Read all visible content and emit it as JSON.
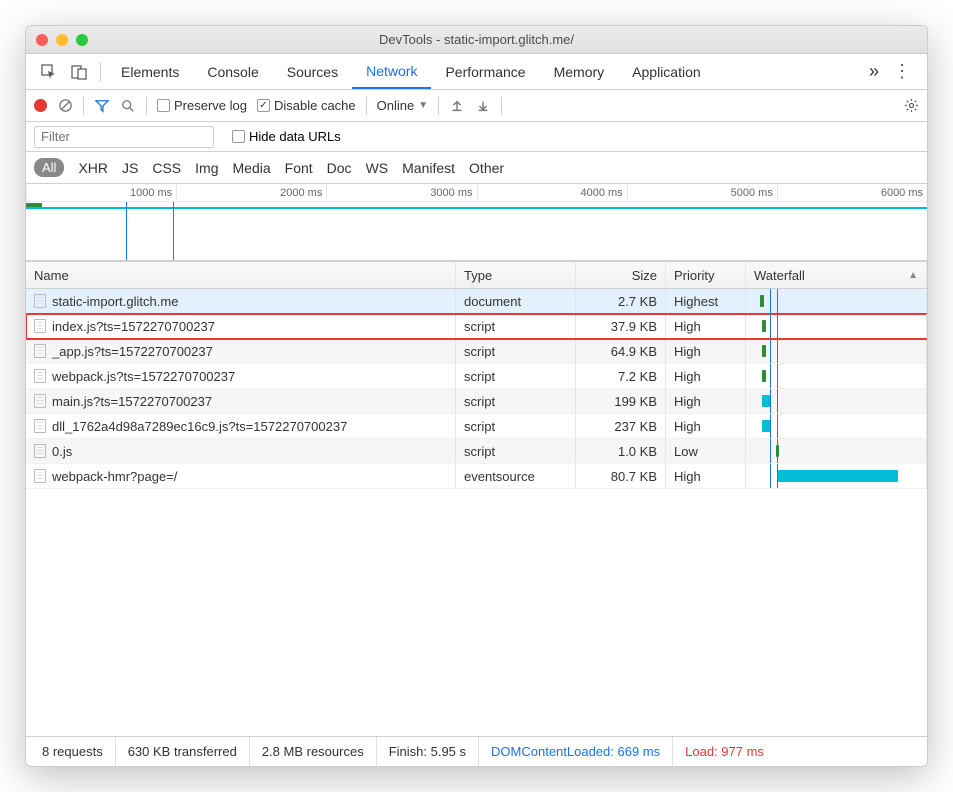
{
  "window": {
    "title": "DevTools - static-import.glitch.me/"
  },
  "tabs": [
    "Elements",
    "Console",
    "Sources",
    "Network",
    "Performance",
    "Memory",
    "Application"
  ],
  "active_tab": "Network",
  "toolbar": {
    "preserve_log_label": "Preserve log",
    "disable_cache_label": "Disable cache",
    "disable_cache_checked": true,
    "throttle": "Online"
  },
  "filter": {
    "placeholder": "Filter",
    "hide_data_urls_label": "Hide data URLs"
  },
  "types": [
    "All",
    "XHR",
    "JS",
    "CSS",
    "Img",
    "Media",
    "Font",
    "Doc",
    "WS",
    "Manifest",
    "Other"
  ],
  "timeline_ticks": [
    "1000 ms",
    "2000 ms",
    "3000 ms",
    "4000 ms",
    "5000 ms",
    "6000 ms"
  ],
  "columns": {
    "name": "Name",
    "type": "Type",
    "size": "Size",
    "priority": "Priority",
    "waterfall": "Waterfall"
  },
  "rows": [
    {
      "name": "static-import.glitch.me",
      "type": "document",
      "size": "2.7 KB",
      "priority": "Highest",
      "wf": {
        "start": 6,
        "width": 4,
        "color": "#2e8b38"
      },
      "sel": true
    },
    {
      "name": "index.js?ts=1572270700237",
      "type": "script",
      "size": "37.9 KB",
      "priority": "High",
      "wf": {
        "start": 8,
        "width": 4,
        "color": "#2e8b38"
      },
      "hl": true
    },
    {
      "name": "_app.js?ts=1572270700237",
      "type": "script",
      "size": "64.9 KB",
      "priority": "High",
      "wf": {
        "start": 8,
        "width": 4,
        "color": "#2e8b38"
      },
      "odd": true
    },
    {
      "name": "webpack.js?ts=1572270700237",
      "type": "script",
      "size": "7.2 KB",
      "priority": "High",
      "wf": {
        "start": 8,
        "width": 4,
        "color": "#2e8b38"
      }
    },
    {
      "name": "main.js?ts=1572270700237",
      "type": "script",
      "size": "199 KB",
      "priority": "High",
      "wf": {
        "start": 8,
        "width": 8,
        "color": "#00bcd4"
      },
      "odd": true
    },
    {
      "name": "dll_1762a4d98a7289ec16c9.js?ts=1572270700237",
      "type": "script",
      "size": "237 KB",
      "priority": "High",
      "wf": {
        "start": 8,
        "width": 8,
        "color": "#00bcd4"
      }
    },
    {
      "name": "0.js",
      "type": "script",
      "size": "1.0 KB",
      "priority": "Low",
      "wf": {
        "start": 22,
        "width": 3,
        "color": "#2e8b38"
      },
      "odd": true
    },
    {
      "name": "webpack-hmr?page=/",
      "type": "eventsource",
      "size": "80.7 KB",
      "priority": "High",
      "wf": {
        "start": 24,
        "width": 120,
        "color": "#00bcd4"
      }
    }
  ],
  "status": {
    "requests": "8 requests",
    "transferred": "630 KB transferred",
    "resources": "2.8 MB resources",
    "finish": "Finish: 5.95 s",
    "dcl": "DOMContentLoaded: 669 ms",
    "load": "Load: 977 ms"
  }
}
